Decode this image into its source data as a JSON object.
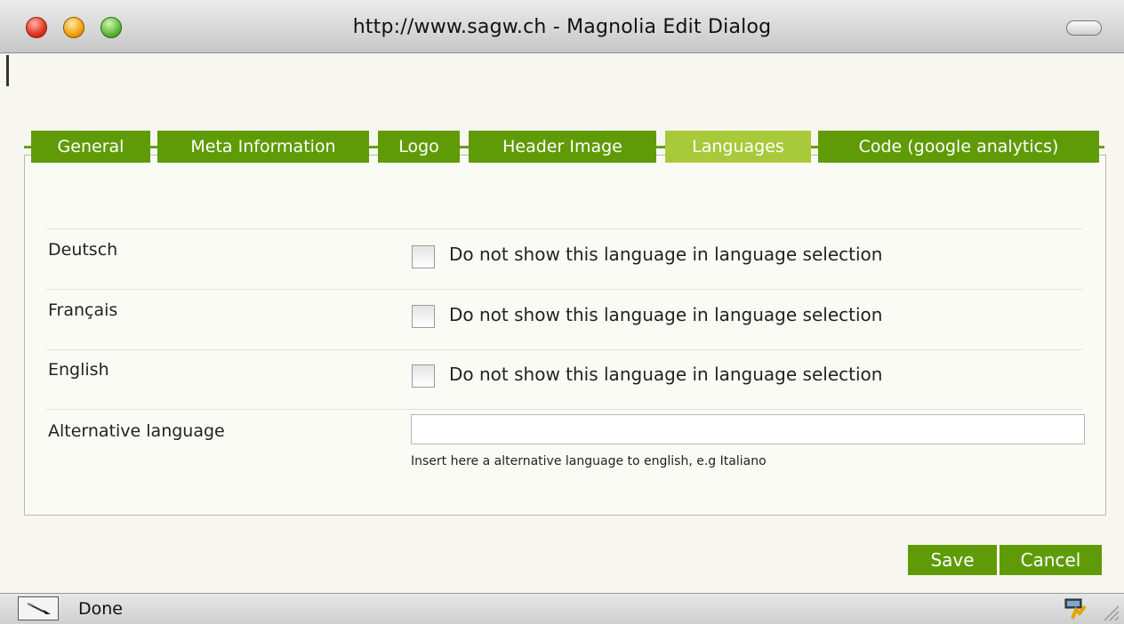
{
  "window": {
    "title": "http://www.sagw.ch - Magnolia Edit Dialog"
  },
  "tabs": [
    {
      "label": "General",
      "active": false
    },
    {
      "label": "Meta Information",
      "active": false
    },
    {
      "label": "Logo",
      "active": false
    },
    {
      "label": "Header Image",
      "active": false
    },
    {
      "label": "Languages",
      "active": true
    },
    {
      "label": "Code (google analytics)",
      "active": false
    }
  ],
  "languages": [
    {
      "label": "Deutsch",
      "checkbox_label": "Do not show this language in language selection",
      "checked": false
    },
    {
      "label": "Français",
      "checkbox_label": "Do not show this language in language selection",
      "checked": false
    },
    {
      "label": "English",
      "checkbox_label": "Do not show this language in language selection",
      "checked": false
    }
  ],
  "alternative": {
    "label": "Alternative language",
    "value": "",
    "hint": "Insert here a alternative language to english, e.g Italiano"
  },
  "buttons": {
    "save": "Save",
    "cancel": "Cancel"
  },
  "statusbar": {
    "text": "Done"
  },
  "colors": {
    "tab_bg": "#5f9b06",
    "tab_active_bg": "#a8c93a",
    "button_bg": "#5f9b06"
  },
  "icons": [
    "pen-icon",
    "security-icon",
    "resize-grip-icon"
  ]
}
